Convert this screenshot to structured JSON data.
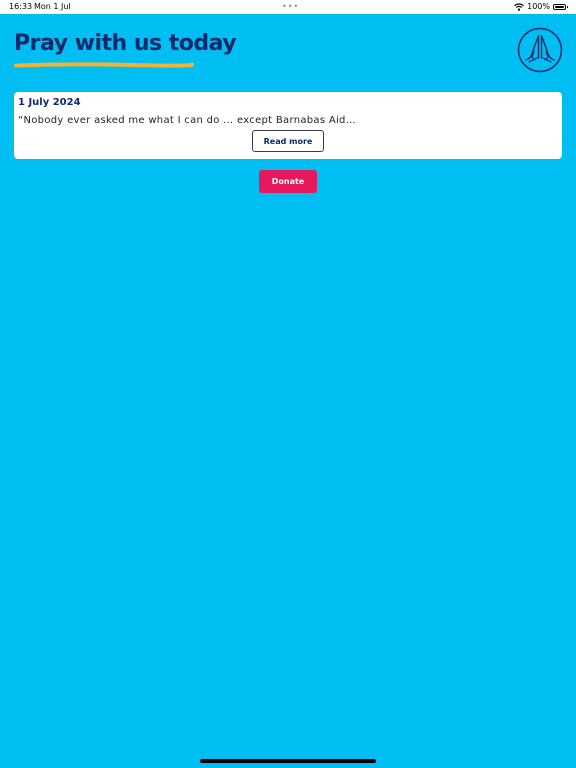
{
  "status_bar": {
    "time": "16:33",
    "date": "Mon 1 Jul",
    "dots": "•••",
    "battery": "100%",
    "icons": [
      "wifi-icon",
      "battery-icon"
    ]
  },
  "header": {
    "title": "Pray with us today",
    "icon": "praying-hands-icon"
  },
  "card": {
    "date": "1 July 2024",
    "excerpt": "“Nobody ever asked me what I can do … except Barnabas Aid…",
    "read_more_label": "Read more"
  },
  "donate": {
    "label": "Donate"
  },
  "colors": {
    "background": "#00BEF2",
    "title": "#0E2A6B",
    "underline": "#F2B233",
    "donate": "#E8185C",
    "card": "#FFFFFF"
  }
}
